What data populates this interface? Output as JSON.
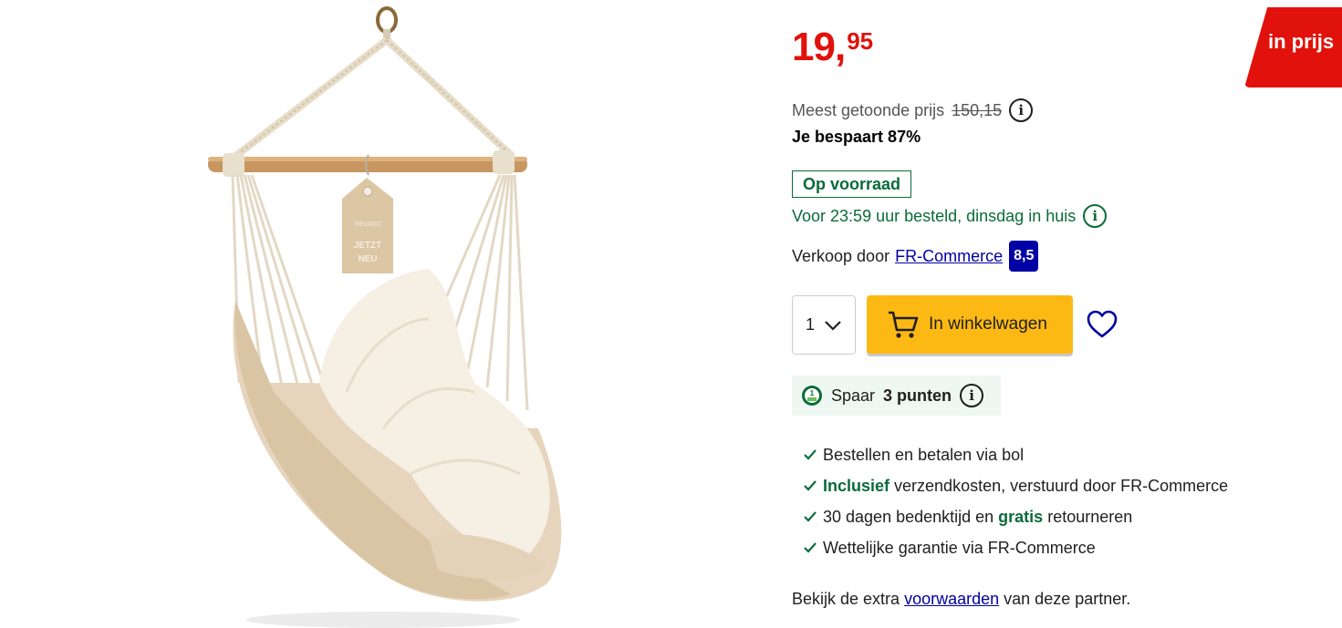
{
  "product": {
    "image_alt": "hangstoel",
    "tag_brand": "REVADO",
    "tag_text_1": "JETZT",
    "tag_text_2": "NEU"
  },
  "price": {
    "integer": "19",
    "comma": ",",
    "decimals": "95",
    "color": "#e0120b"
  },
  "deal_badge": "in prijs",
  "reference": {
    "label": "Meest getoonde prijs",
    "old_price": "150,15"
  },
  "saving": "Je bespaart 87%",
  "stock_label": "Op voorraad",
  "delivery_text": "Voor 23:59 uur besteld, dinsdag in huis",
  "seller": {
    "prefix": "Verkoop door",
    "name": "FR-Commerce",
    "rating": "8,5"
  },
  "quantity": "1",
  "cart_button": "In winkelwagen",
  "points": {
    "prefix": "Spaar",
    "value": "3 punten"
  },
  "usps": [
    {
      "pre": "",
      "bold": "",
      "post": "Bestellen en betalen via bol"
    },
    {
      "pre": "",
      "bold": "Inclusief",
      "post": " verzendkosten, verstuurd door FR-Commerce"
    },
    {
      "pre": "30 dagen bedenktijd en ",
      "bold": "gratis",
      "post": " retourneren"
    },
    {
      "pre": "",
      "bold": "",
      "post": "Wettelijke garantie via FR-Commerce"
    }
  ],
  "conditions": {
    "pre": "Bekijk de extra",
    "link": "voorwaarden",
    "post": "van deze partner."
  },
  "colors": {
    "accent_red": "#e0120b",
    "green": "#0b6b3a",
    "link_blue": "#0000a4",
    "button_yellow": "#fdb913"
  }
}
